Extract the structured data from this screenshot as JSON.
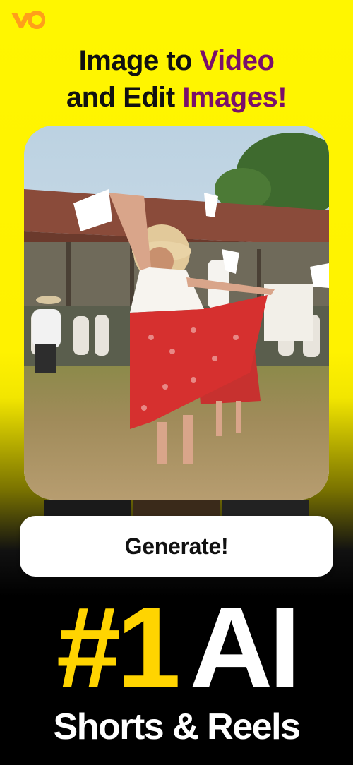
{
  "app": {
    "logo_text": "VO"
  },
  "headline": {
    "line1_prefix": "Image to ",
    "line1_accent": "Video",
    "line2_prefix": "and Edit ",
    "line2_accent": "Images!"
  },
  "generate_button": {
    "label": "Generate!"
  },
  "rank": {
    "number": "#1",
    "ai": "AI"
  },
  "tagline": "Shorts & Reels",
  "colors": {
    "accent_purple": "#7a0f6b",
    "accent_yellow": "#ffd400",
    "background_yellow": "#fff600",
    "logo_orange": "#ff9f1a"
  }
}
